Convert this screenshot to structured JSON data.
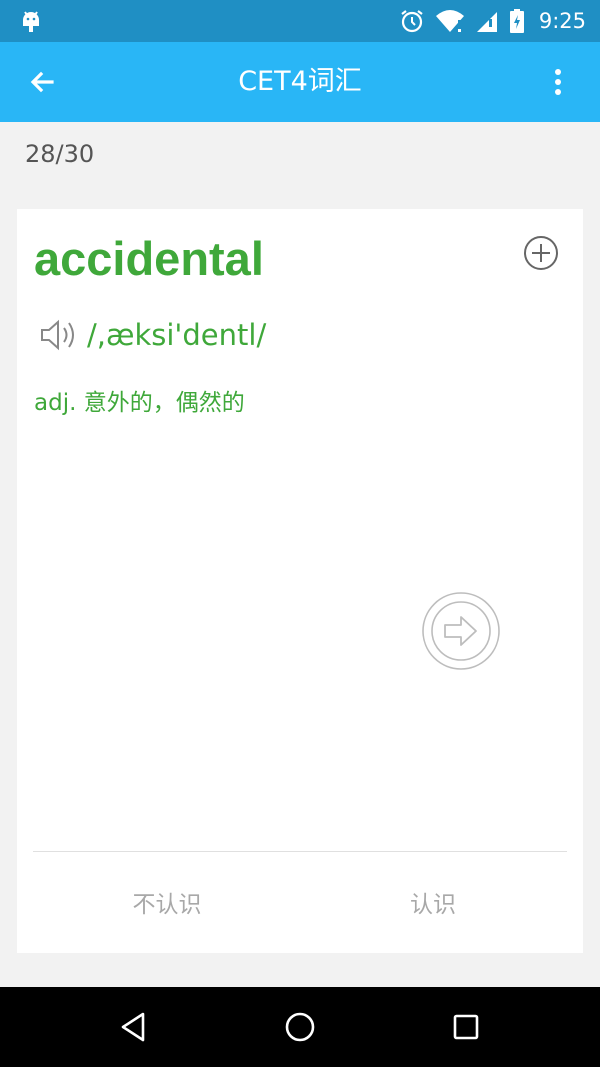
{
  "status_bar": {
    "time": "9:25",
    "icons": [
      "android-icon",
      "alarm-icon",
      "wifi-icon",
      "signal-icon",
      "battery-icon"
    ]
  },
  "app_bar": {
    "title": "CET4词汇",
    "back_icon": "arrow-back-icon",
    "menu_icon": "more-vert-icon"
  },
  "progress": "28/30",
  "card": {
    "word": "accidental",
    "phonetic": "/,æksi'dentl/",
    "meaning": "adj. 意外的，偶然的",
    "add_icon": "add-circle-icon",
    "speaker_icon": "speaker-icon",
    "next_icon": "next-arrow-circle-icon",
    "unknown_label": "不认识",
    "known_label": "认识"
  },
  "nav_bar": {
    "icons": [
      "back-triangle-icon",
      "home-circle-icon",
      "recents-square-icon"
    ]
  },
  "colors": {
    "status_bar": "#1f8fc4",
    "app_bar": "#29b6f6",
    "accent_green": "#3fa83a",
    "background": "#f2f2f2"
  }
}
